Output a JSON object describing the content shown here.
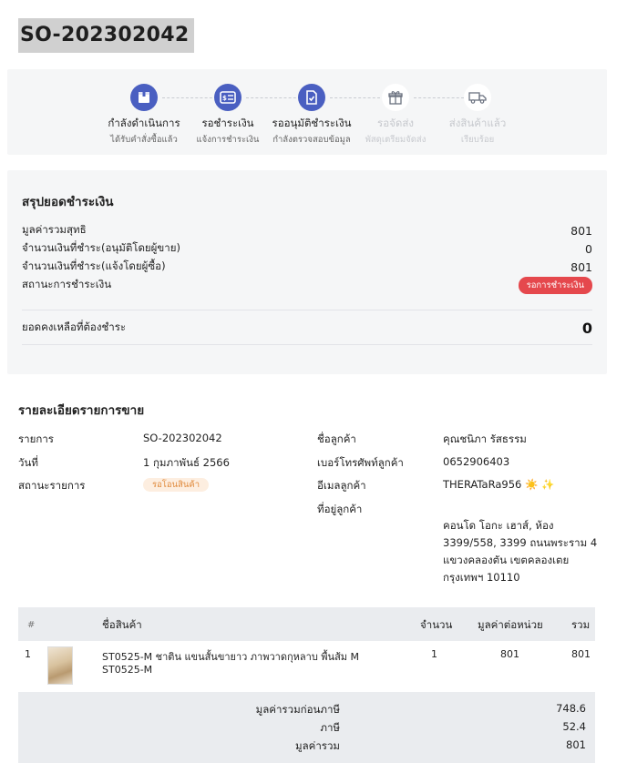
{
  "order": {
    "number": "SO-202302042"
  },
  "steps": [
    {
      "label": "กำลังดำเนินการ",
      "sub": "ได้รับคำสั่งซื้อแล้ว",
      "icon": "box-icon",
      "active": true
    },
    {
      "label": "รอชำระเงิน",
      "sub": "แจ้งการชำระเงิน",
      "icon": "payment-card-icon",
      "active": true
    },
    {
      "label": "รออนุมัติชำระเงิน",
      "sub": "กำลังตรวจสอบข้อมูล",
      "icon": "document-check-icon",
      "active": true
    },
    {
      "label": "รอจัดส่ง",
      "sub": "พัสดุเตรียมจัดส่ง",
      "icon": "gift-box-icon",
      "active": false
    },
    {
      "label": "ส่งสินค้าแล้ว",
      "sub": "เรียบร้อย",
      "icon": "truck-icon",
      "active": false
    }
  ],
  "summary": {
    "title": "สรุปยอดชำระเงิน",
    "rows": [
      {
        "label": "มูลค่ารวมสุทธิ",
        "value": "801"
      },
      {
        "label": "จำนวนเงินที่ชำระ(อนุมัติโดยผู้ขาย)",
        "value": "0"
      },
      {
        "label": "จำนวนเงินที่ชำระ(แจ้งโดยผู้ซื้อ)",
        "value": "801"
      }
    ],
    "status_label": "สถานะการชำระเงิน",
    "status_badge": "รอการชำระเงิน",
    "balance_label": "ยอดคงเหลือที่ต้องชำระ",
    "balance_value": "0"
  },
  "details": {
    "title": "รายละเอียดรายการขาย",
    "order_label": "รายการ",
    "order_value": "SO-202302042",
    "date_label": "วันที่",
    "date_value": "1 กุมภาพันธ์ 2566",
    "status_label": "สถานะรายการ",
    "status_badge": "รอโอนสินค้า",
    "customer_name_label": "ชื่อลูกค้า",
    "customer_name_value": "คุณชนิภา รัสธรรม",
    "phone_label": "เบอร์โทรศัพท์ลูกค้า",
    "phone_value": "0652906403",
    "email_label": "อีเมลลูกค้า",
    "email_value": "THERATaRa956 ☀️ ✨",
    "address_label": "ที่อยู่ลูกค้า",
    "address_value": "คอนโด โอกะ เฮาส์, ห้อง 3399/558, 3399 ถนนพระราม 4 แขวงคลองตัน เขตคลองเตย กรุงเทพฯ 10110"
  },
  "table": {
    "headers": {
      "index": "#",
      "name": "ชื่อสินค้า",
      "qty": "จำนวน",
      "unit_price": "มูลค่าต่อหน่วย",
      "total": "รวม"
    },
    "rows": [
      {
        "index": "1",
        "name_line1": "ST0525-M ชาติน แขนสั้นขายาว ภาพวาดกุหลาบ พื้นส้ม M",
        "name_line2": "ST0525-M",
        "qty": "1",
        "unit_price": "801",
        "total": "801"
      }
    ]
  },
  "totals": {
    "subtotal_label": "มูลค่ารวมก่อนภาษี",
    "subtotal_value": "748.6",
    "tax_label": "ภาษี",
    "tax_value": "52.4",
    "grand_label": "มูลค่ารวม",
    "grand_value": "801"
  },
  "colors": {
    "accent": "#4a5fc1",
    "danger": "#e5484d",
    "warning_bg": "#fdeee0",
    "warning_text": "#e08a3c"
  }
}
